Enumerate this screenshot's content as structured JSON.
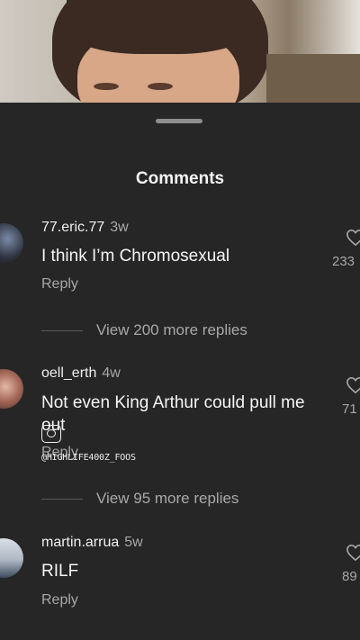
{
  "sheet": {
    "title": "Comments"
  },
  "comments": [
    {
      "username": "77.eric.77",
      "time": "3w",
      "text": "I think I’m Chromosexual",
      "reply_label": "Reply",
      "likes": "233",
      "view_more": "View 200 more replies"
    },
    {
      "username": "oell_erth",
      "time": "4w",
      "text_line1": "Not even King Arthur could pull me",
      "text_line2": "out",
      "reply_label": "Reply",
      "likes": "71",
      "view_more": "View 95 more replies"
    },
    {
      "username": "martin.arrua",
      "time": "5w",
      "text": "RILF",
      "reply_label": "Reply",
      "likes": "89"
    }
  ],
  "watermark": "@HIGHLIFE400Z_FOOS",
  "icons": {
    "like": "heart-outline-icon",
    "watermark": "instagram-icon"
  },
  "colors": {
    "background": "#262626",
    "primary_text": "#f5f5f5",
    "secondary_text": "#a8a8a8"
  }
}
